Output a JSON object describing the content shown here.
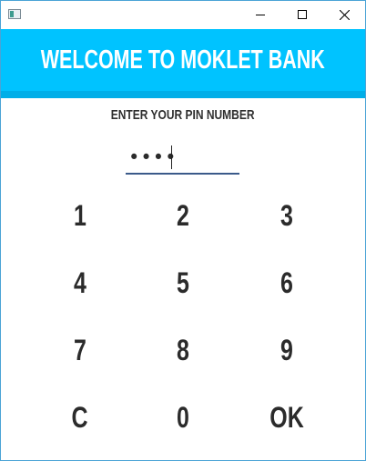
{
  "window": {
    "icon": "app-icon",
    "controls": [
      "minimize-icon",
      "maximize-icon",
      "close-icon"
    ]
  },
  "header": {
    "title": "WELCOME TO MOKLET BANK",
    "background": "#00c3ff",
    "strip_color": "#00aee8"
  },
  "pin": {
    "label": "ENTER YOUR PIN NUMBER",
    "masked_value": "••••"
  },
  "keypad": {
    "k1": "1",
    "k2": "2",
    "k3": "3",
    "k4": "4",
    "k5": "5",
    "k6": "6",
    "k7": "7",
    "k8": "8",
    "k9": "9",
    "kc": "C",
    "k0": "0",
    "kok": "OK"
  }
}
